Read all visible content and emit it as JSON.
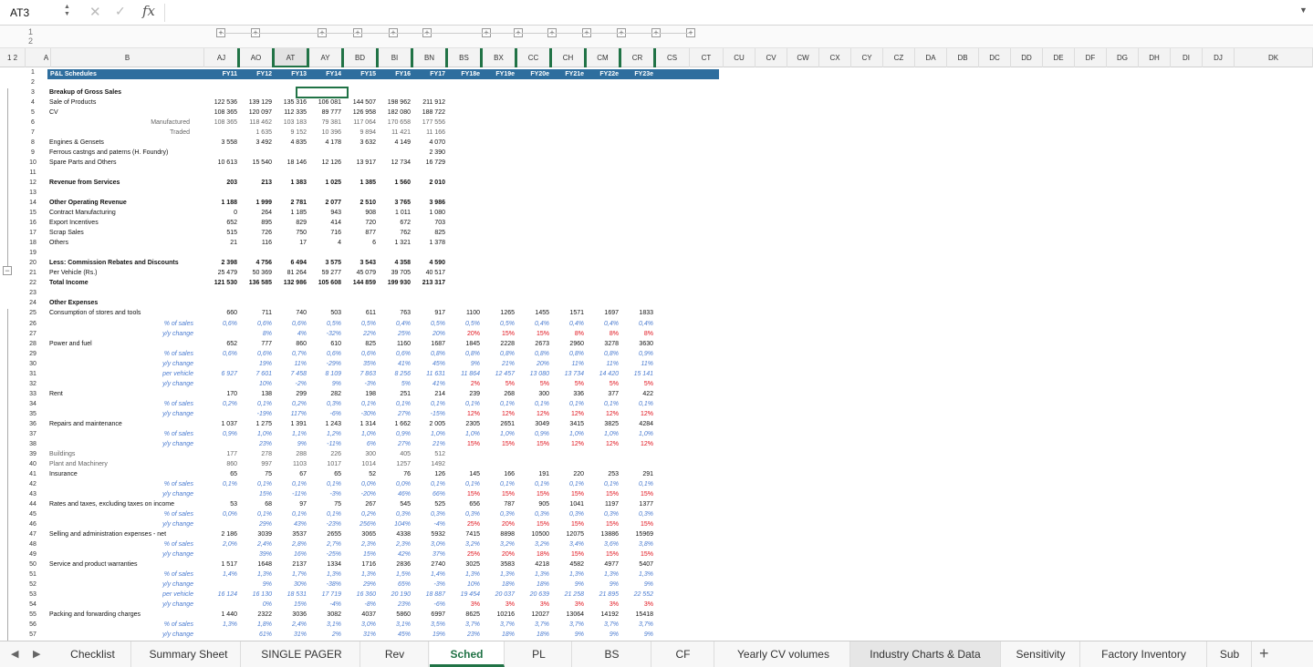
{
  "formula_bar": {
    "cell_ref": "AT3",
    "formula": "",
    "fx": "fx"
  },
  "outline_levels": [
    "1",
    "2"
  ],
  "columns": [
    "A",
    "B",
    "AJ",
    "AO",
    "AT",
    "AY",
    "BD",
    "BI",
    "BN",
    "BS",
    "BX",
    "CC",
    "CH",
    "CM",
    "CR",
    "CS",
    "CT",
    "CU",
    "CV",
    "CW",
    "CX",
    "CY",
    "CZ",
    "DA",
    "DB",
    "DC",
    "DD",
    "DE",
    "DF",
    "DG",
    "DH",
    "DI",
    "DJ",
    "DK"
  ],
  "years": [
    "FY11",
    "FY12",
    "FY13",
    "FY14",
    "FY15",
    "FY16",
    "FY17",
    "FY18e",
    "FY19e",
    "FY20e",
    "FY21e",
    "FY22e",
    "FY23e"
  ],
  "sheet_title": "P&L Schedules",
  "row_numbers": [
    "1",
    "2",
    "3",
    "4",
    "5",
    "6",
    "7",
    "8",
    "9",
    "10",
    "11",
    "12",
    "13",
    "14",
    "15",
    "16",
    "17",
    "18",
    "19",
    "20",
    "21",
    "22",
    "23",
    "24",
    "25",
    "26",
    "27",
    "28",
    "29",
    "30",
    "31",
    "32",
    "33",
    "34",
    "35",
    "36",
    "37",
    "38",
    "39",
    "40",
    "41",
    "42",
    "43",
    "44",
    "45",
    "46",
    "47",
    "48",
    "49",
    "50",
    "51",
    "52",
    "53",
    "54",
    "55",
    "56",
    "57"
  ],
  "rows": [
    {
      "label": "Breakup of Gross Sales",
      "bold": true,
      "v": []
    },
    {
      "label": "Sale of Products",
      "v": [
        "122 536",
        "139 129",
        "135 316",
        "106 081",
        "144 507",
        "198 962",
        "211 912"
      ]
    },
    {
      "label": "CV",
      "v": [
        "108 365",
        "120 097",
        "112 335",
        "89 777",
        "126 958",
        "182 080",
        "188 722"
      ]
    },
    {
      "label": "Manufactured",
      "right": true,
      "gray": true,
      "v": [
        "108 365",
        "118 462",
        "103 183",
        "79 381",
        "117 064",
        "170 658",
        "177 556"
      ]
    },
    {
      "label": "Traded",
      "right": true,
      "gray": true,
      "v": [
        "",
        "1 635",
        "9 152",
        "10 396",
        "9 894",
        "11 421",
        "11 166"
      ]
    },
    {
      "label": "Engines & Gensets",
      "v": [
        "3 558",
        "3 492",
        "4 835",
        "4 178",
        "3 632",
        "4 149",
        "4 070"
      ]
    },
    {
      "label": "Ferrous castngs and paterns (H. Foundry)",
      "v": [
        "",
        "",
        "",
        "",
        "",
        "",
        "2 390"
      ]
    },
    {
      "label": "Spare Parts and Others",
      "v": [
        "10 613",
        "15 540",
        "18 146",
        "12 126",
        "13 917",
        "12 734",
        "16 729"
      ]
    },
    {
      "label": "",
      "v": []
    },
    {
      "label": "Revenue from Services",
      "bold": true,
      "v": [
        "203",
        "213",
        "1 383",
        "1 025",
        "1 385",
        "1 560",
        "2 010"
      ]
    },
    {
      "label": "",
      "v": []
    },
    {
      "label": "Other Operating Revenue",
      "bold": true,
      "v": [
        "1 188",
        "1 999",
        "2 781",
        "2 077",
        "2 510",
        "3 765",
        "3 986"
      ]
    },
    {
      "label": "Contract Manufacturing",
      "v": [
        "0",
        "264",
        "1 185",
        "943",
        "908",
        "1 011",
        "1 080"
      ]
    },
    {
      "label": "Export Incentives",
      "v": [
        "652",
        "895",
        "829",
        "414",
        "720",
        "672",
        "703"
      ]
    },
    {
      "label": "Scrap Sales",
      "v": [
        "515",
        "726",
        "750",
        "716",
        "877",
        "762",
        "825"
      ]
    },
    {
      "label": "Others",
      "v": [
        "21",
        "116",
        "17",
        "4",
        "6",
        "1 321",
        "1 378"
      ]
    },
    {
      "label": "",
      "v": []
    },
    {
      "label": "Less: Commission Rebates and Discounts",
      "bold": true,
      "v": [
        "2 398",
        "4 756",
        "6 494",
        "3 575",
        "3 543",
        "4 358",
        "4 590"
      ]
    },
    {
      "label": "Per Vehicle (Rs.)",
      "v": [
        "25 479",
        "50 369",
        "81 264",
        "59 277",
        "45 079",
        "39 705",
        "40 517"
      ]
    },
    {
      "label": "Total Income",
      "bold": true,
      "v": [
        "121 530",
        "136 585",
        "132 986",
        "105 608",
        "144 859",
        "199 930",
        "213 317"
      ]
    },
    {
      "label": "",
      "v": []
    },
    {
      "label": "Other Expenses",
      "bold": true,
      "v": []
    },
    {
      "label": "Consumption of stores and tools",
      "v": [
        "660",
        "711",
        "740",
        "503",
        "611",
        "763",
        "917",
        "1100",
        "1265",
        "1455",
        "1571",
        "1697",
        "1833"
      ]
    },
    {
      "label": "% of sales",
      "pct": true,
      "v": [
        "0,6%",
        "0,6%",
        "0,6%",
        "0,5%",
        "0,5%",
        "0,4%",
        "0,5%",
        "0,5%",
        "0,5%",
        "0,4%",
        "0,4%",
        "0,4%",
        "0,4%"
      ]
    },
    {
      "label": "y/y change",
      "pct": true,
      "v": [
        "",
        "8%",
        "4%",
        "-32%",
        "22%",
        "25%",
        "20%",
        "20%",
        "15%",
        "15%",
        "8%",
        "8%",
        "8%"
      ],
      "redfrom": 7
    },
    {
      "label": "Power and fuel",
      "v": [
        "652",
        "777",
        "860",
        "610",
        "825",
        "1160",
        "1687",
        "1845",
        "2228",
        "2673",
        "2960",
        "3278",
        "3630"
      ]
    },
    {
      "label": "% of sales",
      "pct": true,
      "v": [
        "0,6%",
        "0,6%",
        "0,7%",
        "0,6%",
        "0,6%",
        "0,6%",
        "0,8%",
        "0,8%",
        "0,8%",
        "0,8%",
        "0,8%",
        "0,8%",
        "0,9%"
      ]
    },
    {
      "label": "y/y change",
      "pct": true,
      "v": [
        "",
        "19%",
        "11%",
        "-29%",
        "35%",
        "41%",
        "45%",
        "9%",
        "21%",
        "20%",
        "11%",
        "11%",
        "11%"
      ]
    },
    {
      "label": "per vehicle",
      "pct": true,
      "v": [
        "6 927",
        "7 601",
        "7 458",
        "8 109",
        "7 863",
        "8 256",
        "11 631",
        "11 864",
        "12 457",
        "13 080",
        "13 734",
        "14 420",
        "15 141"
      ]
    },
    {
      "label": "y/y change",
      "pct": true,
      "v": [
        "",
        "10%",
        "-2%",
        "9%",
        "-3%",
        "5%",
        "41%",
        "2%",
        "5%",
        "5%",
        "5%",
        "5%",
        "5%"
      ],
      "redfrom": 7
    },
    {
      "label": "Rent",
      "v": [
        "170",
        "138",
        "299",
        "282",
        "198",
        "251",
        "214",
        "239",
        "268",
        "300",
        "336",
        "377",
        "422"
      ]
    },
    {
      "label": "% of sales",
      "pct": true,
      "v": [
        "0,2%",
        "0,1%",
        "0,2%",
        "0,3%",
        "0,1%",
        "0,1%",
        "0,1%",
        "0,1%",
        "0,1%",
        "0,1%",
        "0,1%",
        "0,1%",
        "0,1%"
      ]
    },
    {
      "label": "y/y change",
      "pct": true,
      "v": [
        "",
        "-19%",
        "117%",
        "-6%",
        "-30%",
        "27%",
        "-15%",
        "12%",
        "12%",
        "12%",
        "12%",
        "12%",
        "12%"
      ],
      "redfrom": 7
    },
    {
      "label": "Repairs and maintenance",
      "v": [
        "1 037",
        "1 275",
        "1 391",
        "1 243",
        "1 314",
        "1 662",
        "2 005",
        "2305",
        "2651",
        "3049",
        "3415",
        "3825",
        "4284"
      ]
    },
    {
      "label": "% of sales",
      "pct": true,
      "v": [
        "0,9%",
        "1,0%",
        "1,1%",
        "1,2%",
        "1,0%",
        "0,9%",
        "1,0%",
        "1,0%",
        "1,0%",
        "0,9%",
        "1,0%",
        "1,0%",
        "1,0%"
      ]
    },
    {
      "label": "y/y change",
      "pct": true,
      "v": [
        "",
        "23%",
        "9%",
        "-11%",
        "6%",
        "27%",
        "21%",
        "15%",
        "15%",
        "15%",
        "12%",
        "12%",
        "12%"
      ],
      "redfrom": 7
    },
    {
      "label": "Buildings",
      "gray": true,
      "v": [
        "177",
        "278",
        "288",
        "226",
        "300",
        "405",
        "512"
      ]
    },
    {
      "label": "Plant and Machinery",
      "gray": true,
      "v": [
        "860",
        "997",
        "1103",
        "1017",
        "1014",
        "1257",
        "1492"
      ]
    },
    {
      "label": "Insurance",
      "v": [
        "65",
        "75",
        "67",
        "65",
        "52",
        "76",
        "126",
        "145",
        "166",
        "191",
        "220",
        "253",
        "291"
      ]
    },
    {
      "label": "% of sales",
      "pct": true,
      "v": [
        "0,1%",
        "0,1%",
        "0,1%",
        "0,1%",
        "0,0%",
        "0,0%",
        "0,1%",
        "0,1%",
        "0,1%",
        "0,1%",
        "0,1%",
        "0,1%",
        "0,1%"
      ]
    },
    {
      "label": "y/y change",
      "pct": true,
      "v": [
        "",
        "15%",
        "-11%",
        "-3%",
        "-20%",
        "46%",
        "66%",
        "15%",
        "15%",
        "15%",
        "15%",
        "15%",
        "15%"
      ],
      "redfrom": 7
    },
    {
      "label": "Rates and taxes, excluding taxes on income",
      "v": [
        "53",
        "68",
        "97",
        "75",
        "267",
        "545",
        "525",
        "656",
        "787",
        "905",
        "1041",
        "1197",
        "1377"
      ]
    },
    {
      "label": "% of sales",
      "pct": true,
      "v": [
        "0,0%",
        "0,1%",
        "0,1%",
        "0,1%",
        "0,2%",
        "0,3%",
        "0,3%",
        "0,3%",
        "0,3%",
        "0,3%",
        "0,3%",
        "0,3%",
        "0,3%"
      ]
    },
    {
      "label": "y/y change",
      "pct": true,
      "v": [
        "",
        "29%",
        "43%",
        "-23%",
        "256%",
        "104%",
        "-4%",
        "25%",
        "20%",
        "15%",
        "15%",
        "15%",
        "15%"
      ],
      "redfrom": 7
    },
    {
      "label": "Selling and administration expenses - net",
      "v": [
        "2 186",
        "3039",
        "3537",
        "2655",
        "3065",
        "4338",
        "5932",
        "7415",
        "8898",
        "10500",
        "12075",
        "13886",
        "15969"
      ]
    },
    {
      "label": "% of sales",
      "pct": true,
      "v": [
        "2,0%",
        "2,4%",
        "2,8%",
        "2,7%",
        "2,3%",
        "2,3%",
        "3,0%",
        "3,2%",
        "3,2%",
        "3,2%",
        "3,4%",
        "3,6%",
        "3,8%"
      ]
    },
    {
      "label": "y/y change",
      "pct": true,
      "v": [
        "",
        "39%",
        "16%",
        "-25%",
        "15%",
        "42%",
        "37%",
        "25%",
        "20%",
        "18%",
        "15%",
        "15%",
        "15%"
      ],
      "redfrom": 7
    },
    {
      "label": "Service and product warranties",
      "v": [
        "1 517",
        "1648",
        "2137",
        "1334",
        "1716",
        "2836",
        "2740",
        "3025",
        "3583",
        "4218",
        "4582",
        "4977",
        "5407"
      ]
    },
    {
      "label": "% of sales",
      "pct": true,
      "v": [
        "1,4%",
        "1,3%",
        "1,7%",
        "1,3%",
        "1,3%",
        "1,5%",
        "1,4%",
        "1,3%",
        "1,3%",
        "1,3%",
        "1,3%",
        "1,3%",
        "1,3%"
      ]
    },
    {
      "label": "y/y change",
      "pct": true,
      "v": [
        "",
        "9%",
        "30%",
        "-38%",
        "29%",
        "65%",
        "-3%",
        "10%",
        "18%",
        "18%",
        "9%",
        "9%",
        "9%"
      ]
    },
    {
      "label": "per vehicle",
      "pct": true,
      "v": [
        "16 124",
        "16 130",
        "18 531",
        "17 719",
        "16 360",
        "20 190",
        "18 887",
        "19 454",
        "20 037",
        "20 639",
        "21 258",
        "21 895",
        "22 552"
      ]
    },
    {
      "label": "y/y change",
      "pct": true,
      "v": [
        "",
        "0%",
        "15%",
        "-4%",
        "-8%",
        "23%",
        "-6%",
        "3%",
        "3%",
        "3%",
        "3%",
        "3%",
        "3%"
      ],
      "redfrom": 7
    },
    {
      "label": "Packing and forwarding charges",
      "v": [
        "1 440",
        "2322",
        "3036",
        "3082",
        "4037",
        "5860",
        "6997",
        "8625",
        "10216",
        "12027",
        "13064",
        "14192",
        "15418"
      ]
    },
    {
      "label": "% of sales",
      "pct": true,
      "v": [
        "1,3%",
        "1,8%",
        "2,4%",
        "3,1%",
        "3,0%",
        "3,1%",
        "3,5%",
        "3,7%",
        "3,7%",
        "3,7%",
        "3,7%",
        "3,7%",
        "3,7%"
      ]
    },
    {
      "label": "y/y change",
      "pct": true,
      "v": [
        "",
        "61%",
        "31%",
        "2%",
        "31%",
        "45%",
        "19%",
        "23%",
        "18%",
        "18%",
        "9%",
        "9%",
        "9%"
      ]
    }
  ],
  "tabs": [
    "Checklist",
    "Summary Sheet",
    "SINGLE PAGER",
    "Rev",
    "Sched",
    "PL",
    "BS",
    "CF",
    "Yearly CV volumes",
    "Industry Charts & Data",
    "Sensitivity",
    "Factory Inventory",
    "Sub"
  ],
  "active_tab": "Sched"
}
